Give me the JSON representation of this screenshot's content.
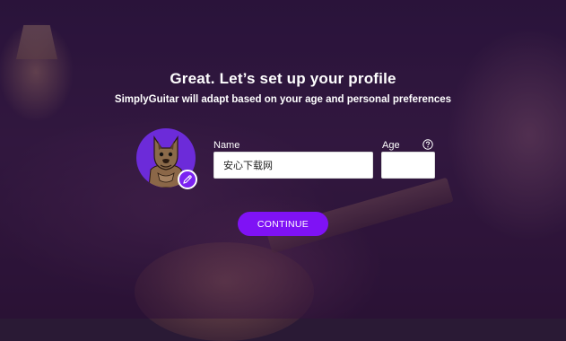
{
  "header": {
    "title": "Great. Let’s set up your profile",
    "subtitle": "SimplyGuitar will adapt based on your age and personal preferences"
  },
  "form": {
    "name_label": "Name",
    "name_value": "安心下载网",
    "age_label": "Age",
    "age_value": ""
  },
  "actions": {
    "continue_label": "CONTINUE"
  },
  "icons": {
    "avatar": "wolf-avatar-icon",
    "edit": "pencil-icon",
    "help": "question-circle-icon"
  },
  "colors": {
    "accent": "#7f12f5",
    "avatar_bg": "#6c2bd9",
    "overlay": "#28103c"
  }
}
